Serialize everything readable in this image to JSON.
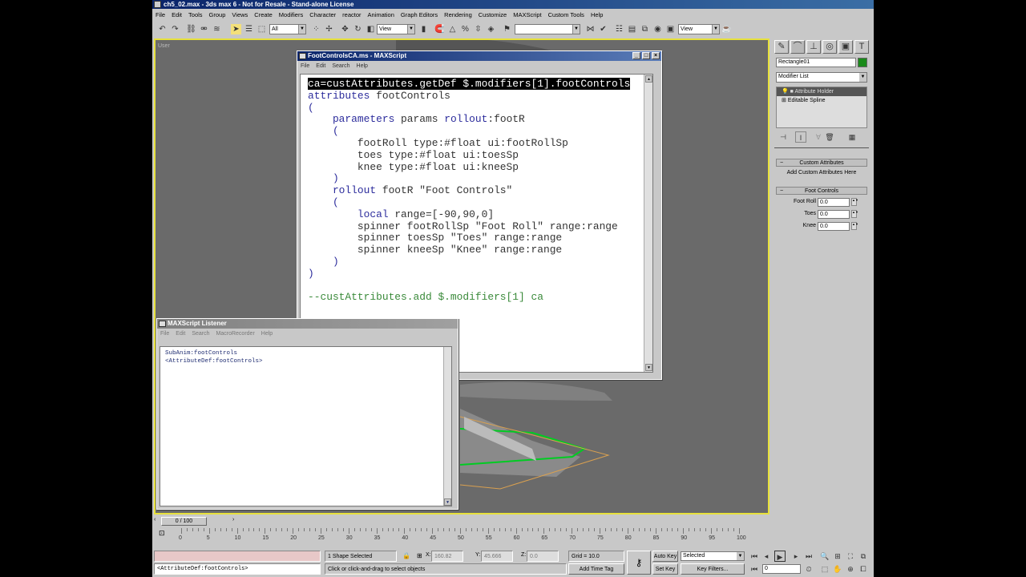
{
  "window": {
    "title": "ch5_02.max - 3ds max 6 - Not for Resale - Stand-alone License"
  },
  "menu": [
    "File",
    "Edit",
    "Tools",
    "Group",
    "Views",
    "Create",
    "Modifiers",
    "Character",
    "reactor",
    "Animation",
    "Graph Editors",
    "Rendering",
    "Customize",
    "MAXScript",
    "Custom Tools",
    "Help"
  ],
  "toolbar": {
    "selection_filter": "All",
    "ref_coord": "View",
    "named_selection": "",
    "view_combo": "View"
  },
  "viewport": {
    "label": "User"
  },
  "editor": {
    "title": "FootControlsCA.ms - MAXScript",
    "menu": [
      "File",
      "Edit",
      "Search",
      "Help"
    ],
    "colors": {
      "k": "#2c2c9c",
      "t": "#333333",
      "c": "#3a8a3a"
    },
    "lines": [
      [
        [
          "ca=custAttributes.getDef $.modifiers[1].footControls",
          "t"
        ]
      ],
      [
        [
          "attributes",
          "k"
        ],
        [
          " footControls",
          "t"
        ]
      ],
      [
        [
          "(",
          "k"
        ]
      ],
      [
        [
          "    parameters",
          "k"
        ],
        [
          " params ",
          "t"
        ],
        [
          "rollout",
          "k"
        ],
        [
          ":footR",
          "t"
        ]
      ],
      [
        [
          "    (",
          "k"
        ]
      ],
      [
        [
          "        footRoll type:#float ui:footRollSp",
          "t"
        ]
      ],
      [
        [
          "        toes type:#float ui:toesSp",
          "t"
        ]
      ],
      [
        [
          "        knee type:#float ui:kneeSp",
          "t"
        ]
      ],
      [
        [
          "    )",
          "k"
        ]
      ],
      [
        [
          "    rollout",
          "k"
        ],
        [
          " footR \"Foot Controls\"",
          "t"
        ]
      ],
      [
        [
          "    (",
          "k"
        ]
      ],
      [
        [
          "        local",
          "k"
        ],
        [
          " range=[-90,90,0]",
          "t"
        ]
      ],
      [
        [
          "        spinner footRollSp \"Foot Roll\" range:range",
          "t"
        ]
      ],
      [
        [
          "        spinner toesSp \"Toes\" range:range",
          "t"
        ]
      ],
      [
        [
          "        spinner kneeSp \"Knee\" range:range",
          "t"
        ]
      ],
      [
        [
          "    )",
          "k"
        ]
      ],
      [
        [
          ")",
          "k"
        ]
      ],
      [
        [
          "",
          "t"
        ]
      ],
      [
        [
          "--custAttributes.add $.modifiers[1] ca",
          "c"
        ]
      ]
    ]
  },
  "listener": {
    "title": "MAXScript Listener",
    "menu": [
      "File",
      "Edit",
      "Search",
      "MacroRecorder",
      "Help"
    ],
    "output": [
      "SubAnim:footControls",
      "<AttributeDef:footControls>"
    ]
  },
  "command_panel": {
    "object_name": "Rectangle01",
    "object_color": "#1a8a1a",
    "modifier_list": "Modifier List",
    "stack": [
      "Attribute Holder",
      "Editable Spline"
    ],
    "rollouts": [
      {
        "title": "Custom Attributes",
        "body": "Add Custom Attributes Here"
      },
      {
        "title": "Foot Controls"
      }
    ],
    "spinners": [
      {
        "label": "Foot Roll",
        "value": "0.0"
      },
      {
        "label": "Toes",
        "value": "0.0"
      },
      {
        "label": "Knee",
        "value": "0.0"
      }
    ]
  },
  "timeline": {
    "slider": "0 / 100",
    "ticks": [
      "0",
      "5",
      "10",
      "15",
      "20",
      "25",
      "30",
      "35",
      "40",
      "45",
      "50",
      "55",
      "60",
      "65",
      "70",
      "75",
      "80",
      "85",
      "90",
      "95",
      "100"
    ]
  },
  "status": {
    "mini_listener_output": "<AttributeDef:footControls>",
    "selection": "1 Shape Selected",
    "prompt": "Click or click-and-drag to select objects",
    "x_label": "X:",
    "x": "160.82",
    "y_label": "Y:",
    "y": "45.666",
    "z_label": "Z:",
    "z": "0.0",
    "grid": "Grid = 10.0",
    "add_time_tag": "Add Time Tag",
    "auto_key": "Auto Key",
    "set_key": "Set Key",
    "key_mode": "Selected",
    "key_filters": "Key Filters...",
    "frame": "0"
  }
}
